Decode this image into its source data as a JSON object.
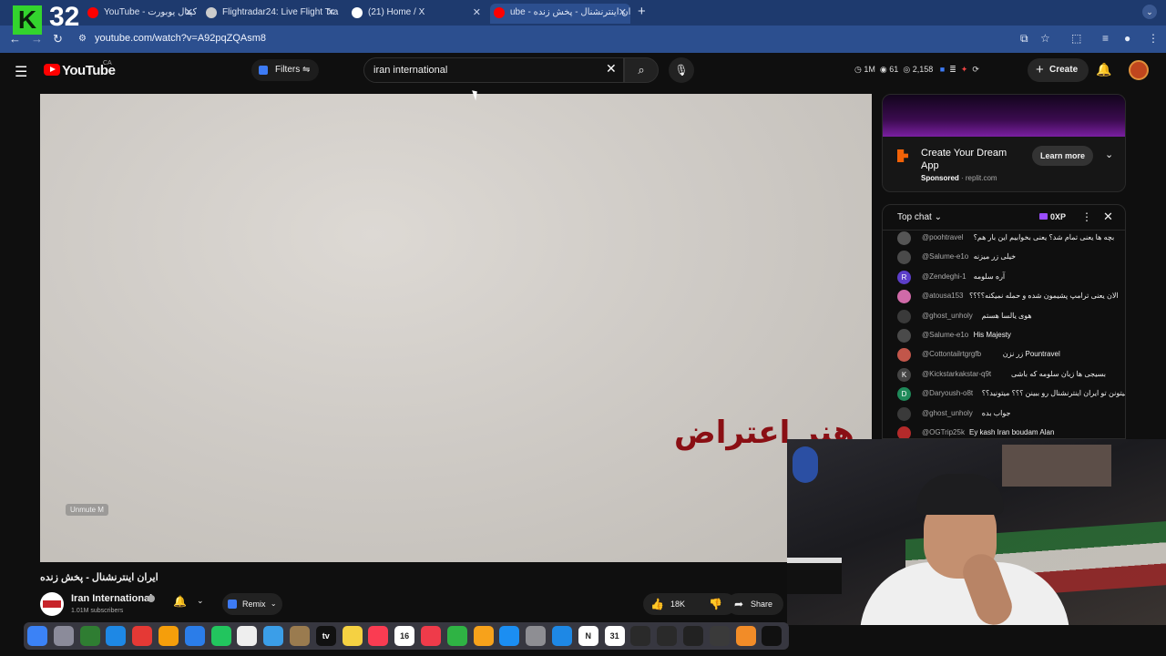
{
  "overlay": {
    "logo_letter": "K",
    "logo_number": "32"
  },
  "browser": {
    "tabs": [
      {
        "title": "YouTube - کیتال یوبورت",
        "icon_color": "#ff0000"
      },
      {
        "title": "Flightradar24: Live Flight Tra",
        "icon_color": "#cccccc"
      },
      {
        "title": "(21) Home / X",
        "icon_color": "#ffffff"
      },
      {
        "title": "ube - ایران اینترنشنال - پخش زنده",
        "icon_color": "#ff0000"
      }
    ],
    "new_tab": "+",
    "url": "youtube.com/watch?v=A92pqZQAsm8"
  },
  "youtube": {
    "logo_text": "YouTube",
    "region": "CA",
    "filters_label": "Filters",
    "search_value": "iran international",
    "stats": {
      "views": "1M",
      "watching": "61",
      "other": "2,158"
    },
    "create_label": "Create"
  },
  "video": {
    "overlay_text": "هنر اعتراض",
    "unmute_label": "Unmute  M",
    "title": "ایران اینترنشنال - پخش زنده"
  },
  "channel": {
    "name": "Iran International",
    "subscribers": "1.01M subscribers",
    "remix_label": "Remix",
    "likes": "18K",
    "share_label": "Share"
  },
  "ad": {
    "title": "Create Your Dream App",
    "sponsored": "Sponsored",
    "domain": "replit.com",
    "cta": "Learn more"
  },
  "chat": {
    "header": "Top chat",
    "badge": "0XP",
    "messages": [
      {
        "author": "@poohtravel",
        "text": "بچه ها یعنی تمام شد؟ یعنی بخوابیم این بار هم؟",
        "avatar_color": "#555555",
        "avatar_letter": ""
      },
      {
        "author": "@Salume-e1o",
        "text": "خیلی زر میزنه",
        "avatar_color": "#4a4a4a",
        "avatar_letter": ""
      },
      {
        "author": "@Zendeghi-1",
        "text": "آره سلومه",
        "avatar_color": "#5c3ec9",
        "avatar_letter": "R"
      },
      {
        "author": "@atousa153",
        "text": "الان یعنی ترامپ پشیمون شده و حمله نمیکنه؟؟؟؟",
        "avatar_color": "#d06aa8",
        "avatar_letter": ""
      },
      {
        "author": "@ghost_unholy",
        "text": "هوی یالسا هستم",
        "avatar_color": "#3a3a3a",
        "avatar_letter": ""
      },
      {
        "author": "@Salume-e1o",
        "text": "His Majesty",
        "avatar_color": "#4a4a4a",
        "avatar_letter": ""
      },
      {
        "author": "@Cottontailrtgrgfb",
        "text": "زر نزن Pountravel",
        "avatar_color": "#c2564a",
        "avatar_letter": ""
      },
      {
        "author": "@Kickstarkakstar-q9t",
        "text": "بسیجی ها زبان سلومه که باشی",
        "avatar_color": "#444444",
        "avatar_letter": "K"
      },
      {
        "author": "@Daryoush-o8t",
        "text": "مردم میتونن تو ایران اینترنشنال رو ببینن ؟؟؟ میتونید؟؟",
        "avatar_color": "#1f8a5a",
        "avatar_letter": "D"
      },
      {
        "author": "@ghost_unholy",
        "text": "جواب بده",
        "avatar_color": "#3a3a3a",
        "avatar_letter": ""
      },
      {
        "author": "@OGTrip25k",
        "text": "Ey kash Iran boudam Alan",
        "avatar_color": "#b42a2a",
        "avatar_letter": ""
      }
    ]
  },
  "dock": {
    "apps": [
      {
        "name": "finder",
        "color": "#3b82f6",
        "label": ""
      },
      {
        "name": "launchpad",
        "color": "#8b8b9a",
        "label": ""
      },
      {
        "name": "app-green",
        "color": "#2f7d32",
        "label": ""
      },
      {
        "name": "safari",
        "color": "#1e88e5",
        "label": ""
      },
      {
        "name": "chrome",
        "color": "#e53935",
        "label": ""
      },
      {
        "name": "photos",
        "color": "#f59e0b",
        "label": ""
      },
      {
        "name": "mail",
        "color": "#2b7de9",
        "label": ""
      },
      {
        "name": "facetime",
        "color": "#22c55e",
        "label": ""
      },
      {
        "name": "calendar-dots",
        "color": "#eeeeee",
        "label": ""
      },
      {
        "name": "freeform",
        "color": "#3b9ee8",
        "label": ""
      },
      {
        "name": "app-brown",
        "color": "#9a7b4f",
        "label": ""
      },
      {
        "name": "tv",
        "color": "#111111",
        "label": "tv"
      },
      {
        "name": "notes",
        "color": "#f5d142",
        "label": ""
      },
      {
        "name": "music",
        "color": "#fa3c52",
        "label": ""
      },
      {
        "name": "calendar",
        "color": "#ffffff",
        "label": "16"
      },
      {
        "name": "news",
        "color": "#ef3b4a",
        "label": ""
      },
      {
        "name": "numbers",
        "color": "#2fb344",
        "label": ""
      },
      {
        "name": "pages",
        "color": "#f7a21b",
        "label": ""
      },
      {
        "name": "app-store",
        "color": "#1b8ef2",
        "label": ""
      },
      {
        "name": "settings",
        "color": "#8e8e93",
        "label": ""
      },
      {
        "name": "app-blue",
        "color": "#1e88e5",
        "label": ""
      },
      {
        "name": "notion",
        "color": "#ffffff",
        "label": "N"
      },
      {
        "name": "calendar-31",
        "color": "#ffffff",
        "label": "31"
      },
      {
        "name": "app-dark-1",
        "color": "#2a2a2a",
        "label": ""
      },
      {
        "name": "app-dark-2",
        "color": "#2a2a2a",
        "label": ""
      },
      {
        "name": "unity",
        "color": "#222222",
        "label": ""
      },
      {
        "name": "app-gear",
        "color": "#3a3a3a",
        "label": ""
      },
      {
        "name": "fl-studio",
        "color": "#f28c28",
        "label": ""
      },
      {
        "name": "capcut",
        "color": "#111111",
        "label": ""
      }
    ]
  }
}
